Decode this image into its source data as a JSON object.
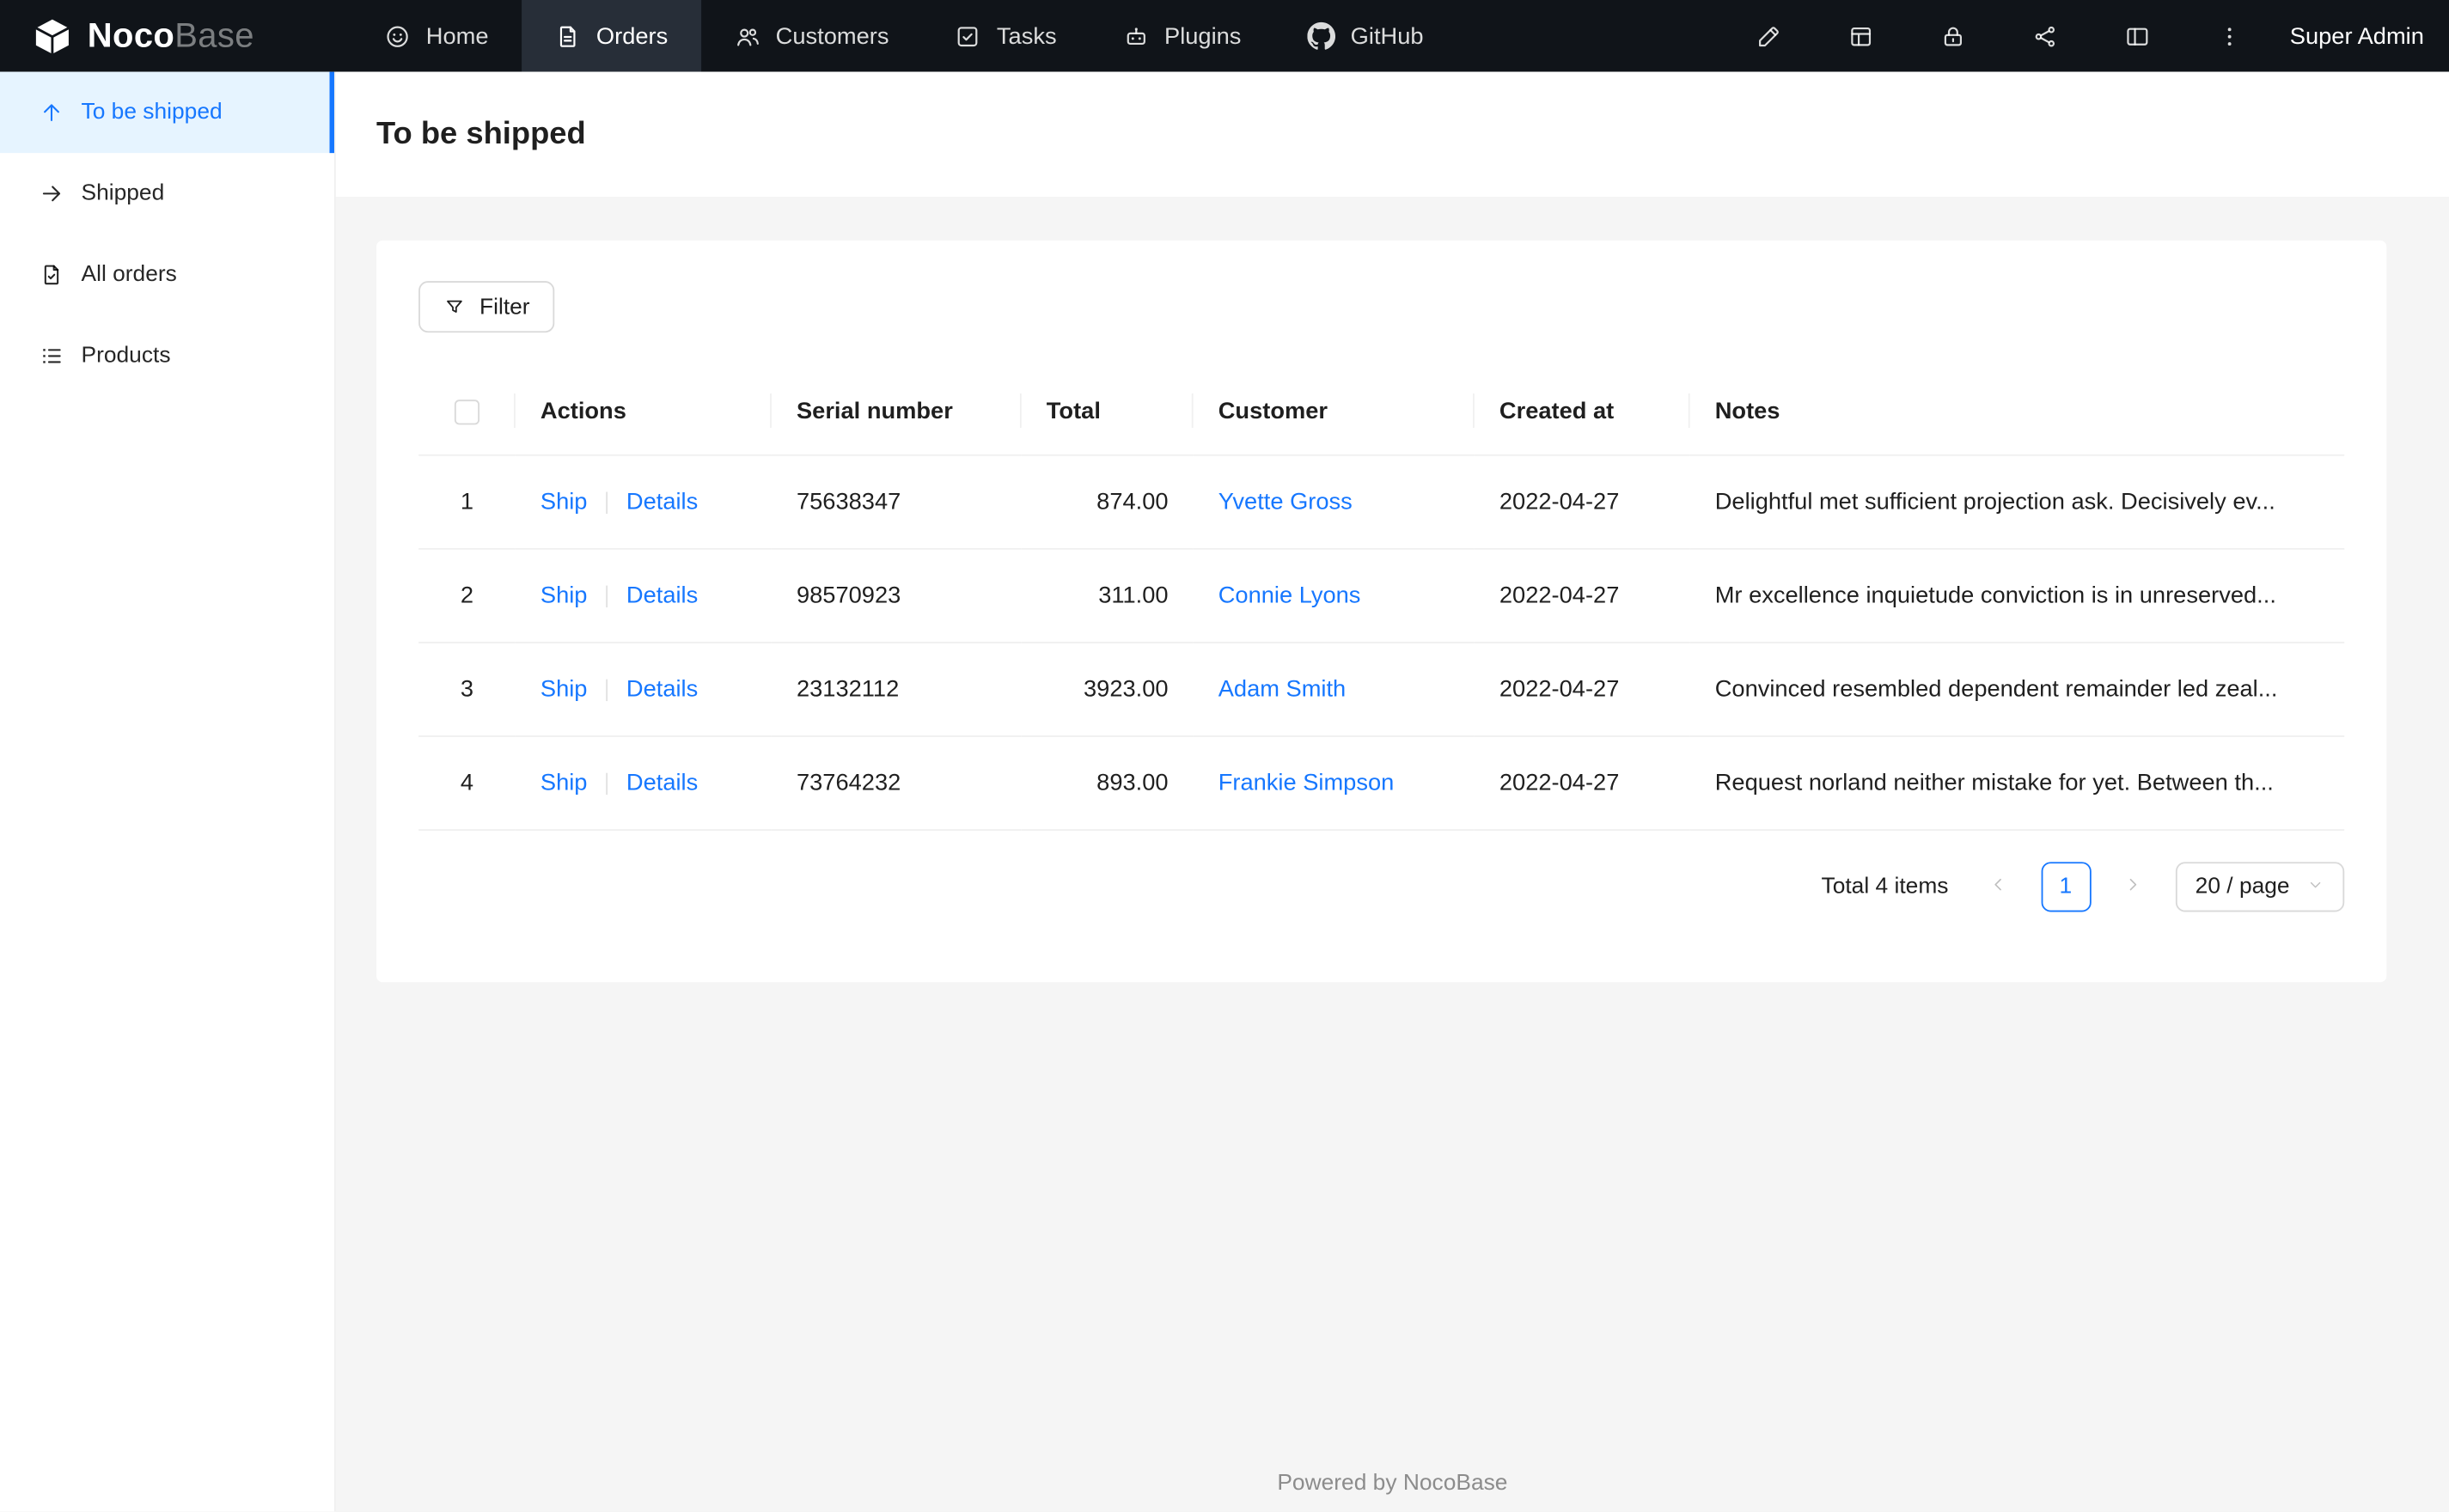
{
  "colors": {
    "primary": "#1677ff",
    "navbar_bg": "#101419",
    "navbar_active_bg": "#272e38",
    "sidebar_active_bg": "#e6f4ff",
    "content_bg": "#f5f5f5",
    "border": "#f0f0f0",
    "link": "#1677ff"
  },
  "navbar": {
    "logo": {
      "text_bold": "Noco",
      "text_light": "Base",
      "icon": "nocobase-cube-icon"
    },
    "items": [
      {
        "label": "Home",
        "icon": "home-smile-icon",
        "active": false
      },
      {
        "label": "Orders",
        "icon": "orders-file-icon",
        "active": true
      },
      {
        "label": "Customers",
        "icon": "customers-people-icon",
        "active": false
      },
      {
        "label": "Tasks",
        "icon": "tasks-check-icon",
        "active": false
      },
      {
        "label": "Plugins",
        "icon": "plugins-robot-icon",
        "active": false
      },
      {
        "label": "GitHub",
        "icon": "github-icon",
        "active": false
      }
    ],
    "right_icons": [
      "highlighter-icon",
      "collections-table-icon",
      "lock-icon",
      "api-nodes-icon",
      "layout-icon",
      "more-vertical-icon"
    ],
    "user_label": "Super Admin"
  },
  "sidebar": {
    "items": [
      {
        "label": "To be shipped",
        "icon": "arrow-up-icon",
        "active": true
      },
      {
        "label": "Shipped",
        "icon": "arrow-right-icon",
        "active": false
      },
      {
        "label": "All orders",
        "icon": "file-check-icon",
        "active": false
      },
      {
        "label": "Products",
        "icon": "list-icon",
        "active": false
      }
    ]
  },
  "page": {
    "title": "To be shipped"
  },
  "toolbar": {
    "filter_label": "Filter"
  },
  "table": {
    "headers": [
      "Actions",
      "Serial number",
      "Total",
      "Customer",
      "Created at",
      "Notes"
    ],
    "action_labels": {
      "ship": "Ship",
      "details": "Details"
    },
    "rows": [
      {
        "index": "1",
        "serial_number": "75638347",
        "total": "874.00",
        "customer": "Yvette Gross",
        "created_at": "2022-04-27",
        "notes": "Delightful met sufficient projection ask. Decisively ev..."
      },
      {
        "index": "2",
        "serial_number": "98570923",
        "total": "311.00",
        "customer": "Connie Lyons",
        "created_at": "2022-04-27",
        "notes": "Mr excellence inquietude conviction is in unreserved..."
      },
      {
        "index": "3",
        "serial_number": "23132112",
        "total": "3923.00",
        "customer": "Adam Smith",
        "created_at": "2022-04-27",
        "notes": "Convinced resembled dependent remainder led zeal..."
      },
      {
        "index": "4",
        "serial_number": "73764232",
        "total": "893.00",
        "customer": "Frankie Simpson",
        "created_at": "2022-04-27",
        "notes": "Request norland neither mistake for yet. Between th..."
      }
    ]
  },
  "pagination": {
    "total_text": "Total 4 items",
    "current_page": "1",
    "page_size_label": "20 / page"
  },
  "footer": {
    "text": "Powered by NocoBase"
  }
}
